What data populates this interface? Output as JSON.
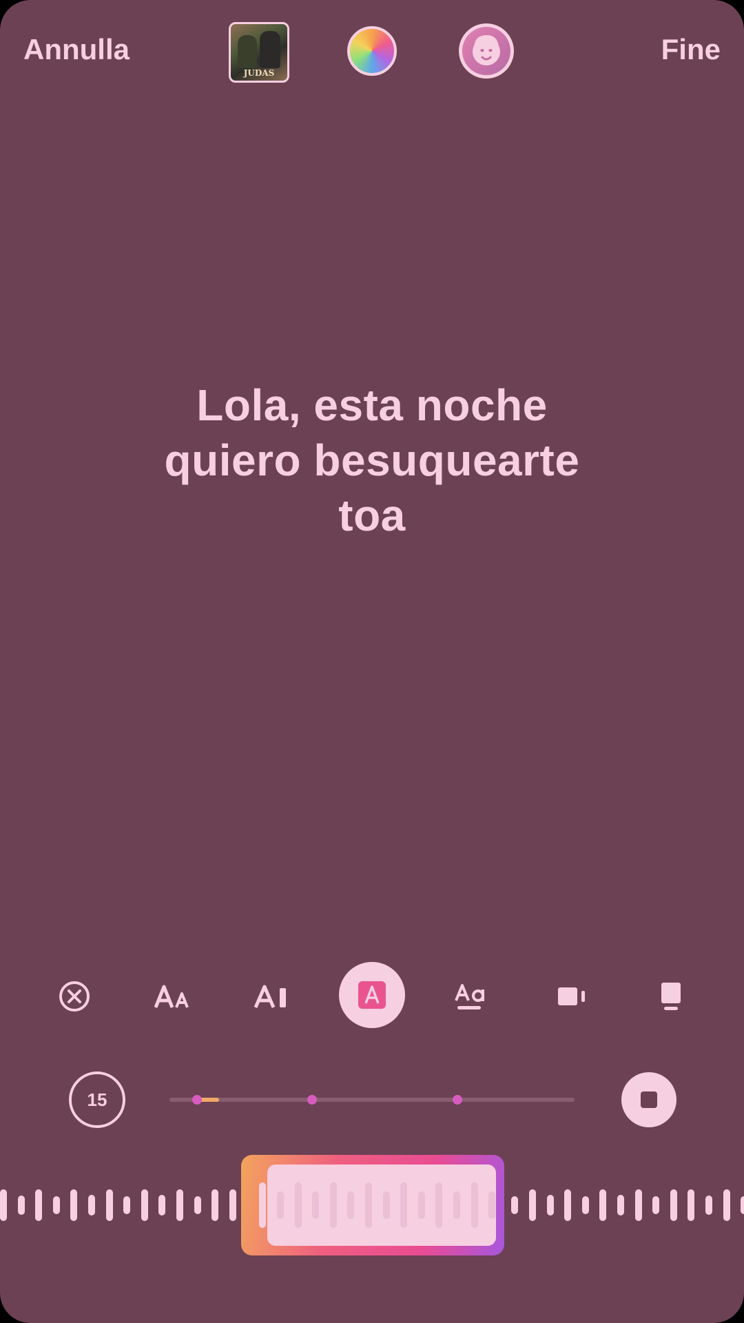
{
  "header": {
    "cancel_label": "Annulla",
    "done_label": "Fine",
    "album_art_text": "JUDAS"
  },
  "lyrics": {
    "line1": "Lola, esta noche",
    "line2": "quiero besuquearte",
    "line3": "toa"
  },
  "toolbar": {
    "icons": [
      "close-circle-icon",
      "text-size-icon",
      "text-cursor-icon",
      "text-style-highlight-icon",
      "font-underline-icon",
      "video-layout-icon",
      "card-layout-icon"
    ],
    "active_index": 3
  },
  "player": {
    "duration_label": "15",
    "progress_fraction": 0.06
  },
  "colors": {
    "background": "#6b4153",
    "foreground": "#f6cfe1",
    "accent_gradient": [
      "#f3a45e",
      "#ee5f7f",
      "#e94c93",
      "#a757de"
    ]
  }
}
